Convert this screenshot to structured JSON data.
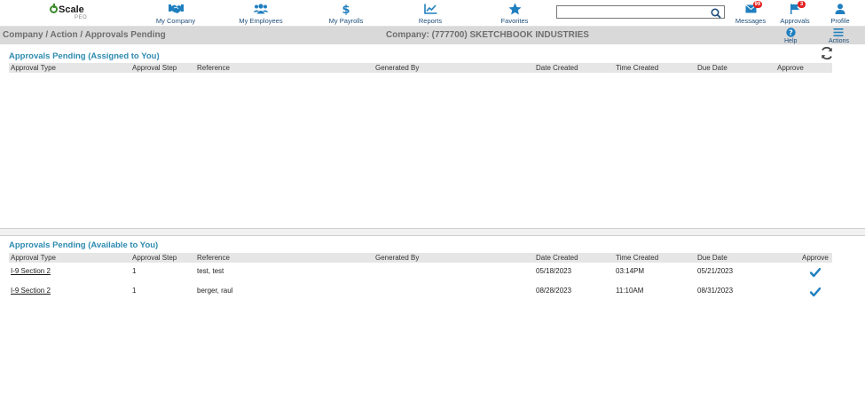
{
  "logo": {
    "main": "Scale",
    "sub": "PEO"
  },
  "nav": [
    {
      "label": "My Company",
      "icon": "handshake-icon"
    },
    {
      "label": "My Employees",
      "icon": "people-icon"
    },
    {
      "label": "My Payrolls",
      "icon": "dollar-icon"
    },
    {
      "label": "Reports",
      "icon": "line-chart-icon"
    },
    {
      "label": "Favorites",
      "icon": "star-icon"
    }
  ],
  "search": {
    "value": "",
    "placeholder": ""
  },
  "right_nav": [
    {
      "label": "Messages",
      "icon": "envelope-icon",
      "badge": "99"
    },
    {
      "label": "Approvals",
      "icon": "flag-icon",
      "badge": "3"
    },
    {
      "label": "Profile",
      "icon": "person-icon"
    }
  ],
  "actionbar": {
    "breadcrumb": "Company / Action / Approvals Pending",
    "company": "Company: (777700) SKETCHBOOK INDUSTRIES",
    "help_label": "Help",
    "actions_label": "Actions"
  },
  "columns": [
    "Approval Type",
    "Approval Step",
    "Reference",
    "Generated By",
    "Date Created",
    "Time Created",
    "Due Date",
    "Approve"
  ],
  "assigned": {
    "title": "Approvals Pending (Assigned to You)",
    "rows": []
  },
  "available": {
    "title": "Approvals Pending (Available to You)",
    "rows": [
      {
        "type": "I-9 Section 2",
        "step": "1",
        "reference": "test, test",
        "generated_by": "",
        "date_created": "05/18/2023",
        "time_created": "03:14PM",
        "due_date": "05/21/2023"
      },
      {
        "type": "I-9 Section 2",
        "step": "1",
        "reference": "berger, raul",
        "generated_by": "",
        "date_created": "08/28/2023",
        "time_created": "11:10AM",
        "due_date": "08/31/2023"
      }
    ]
  },
  "colors": {
    "nav_blue": "#1f4e79",
    "title_teal": "#2d8bb0",
    "icon_blue": "#1f7fbf",
    "badge_red": "#e32020",
    "bar_gray": "#d9d9d9"
  }
}
